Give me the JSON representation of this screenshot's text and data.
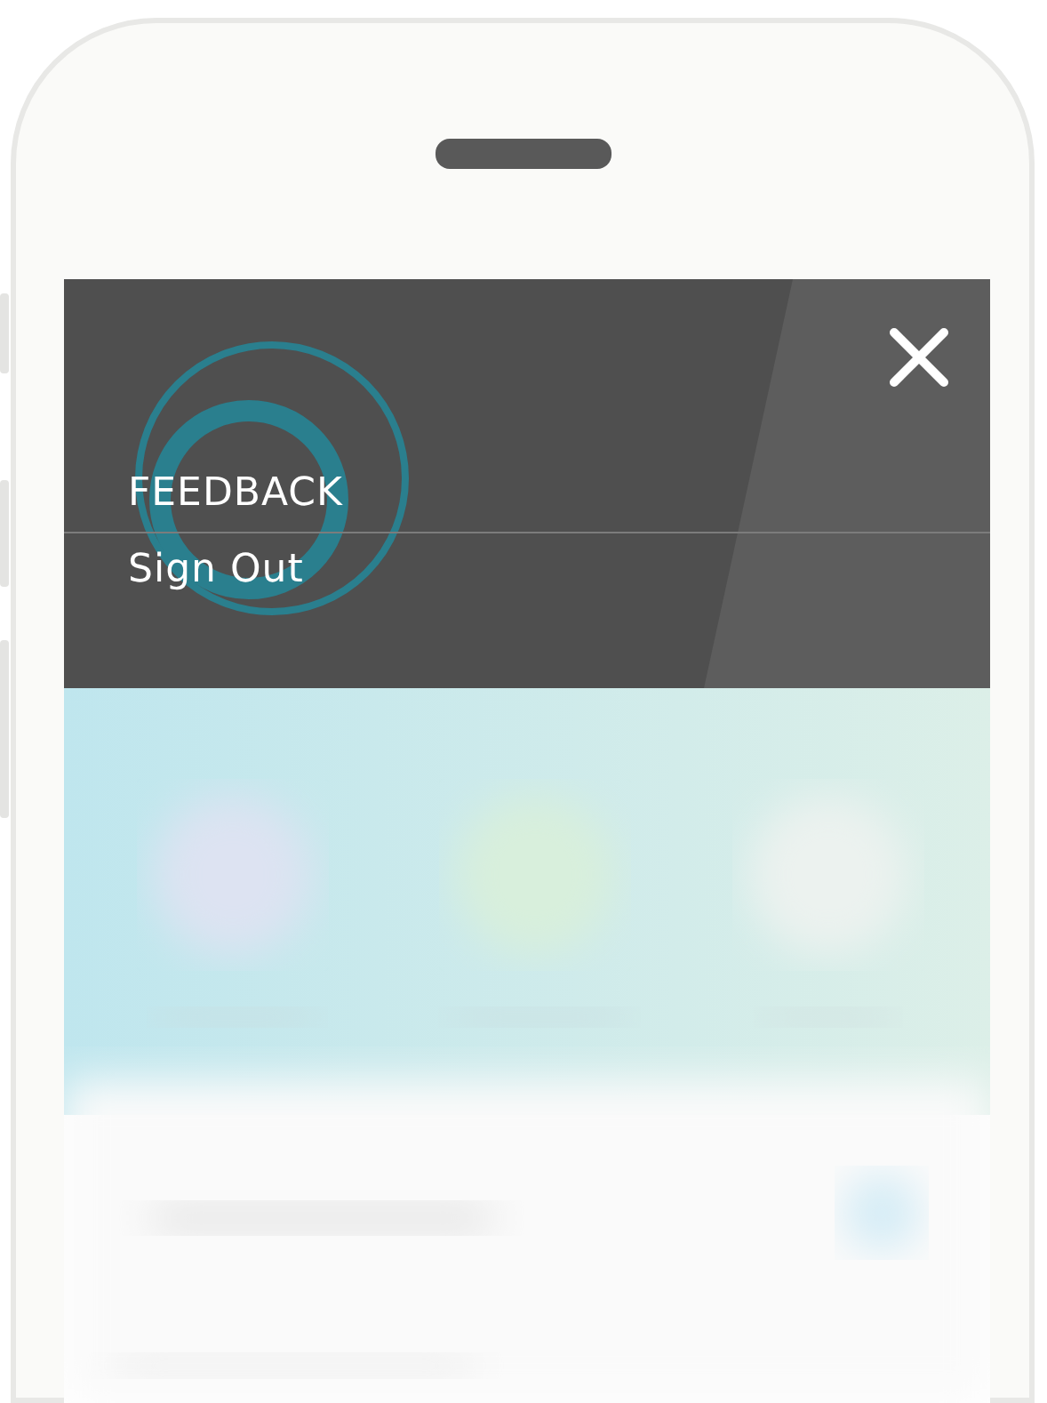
{
  "menu": {
    "items": [
      {
        "label": "FEEDBACK"
      },
      {
        "label": "Sign Out"
      }
    ]
  }
}
